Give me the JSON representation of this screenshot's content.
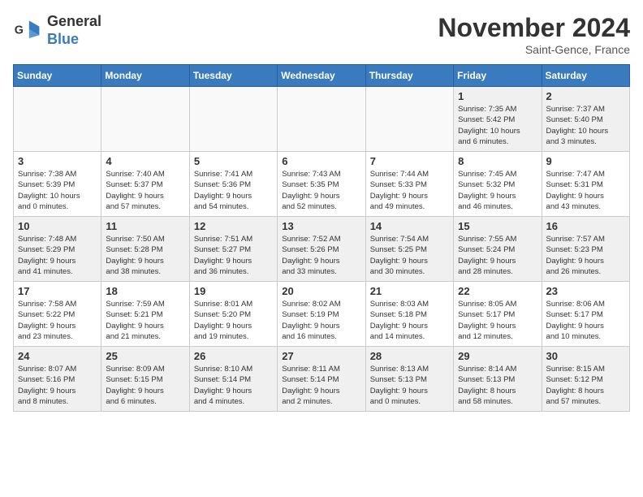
{
  "logo": {
    "line1": "General",
    "line2": "Blue"
  },
  "title": "November 2024",
  "location": "Saint-Gence, France",
  "days_of_week": [
    "Sunday",
    "Monday",
    "Tuesday",
    "Wednesday",
    "Thursday",
    "Friday",
    "Saturday"
  ],
  "weeks": [
    [
      {
        "day": "",
        "info": "",
        "empty": true
      },
      {
        "day": "",
        "info": "",
        "empty": true
      },
      {
        "day": "",
        "info": "",
        "empty": true
      },
      {
        "day": "",
        "info": "",
        "empty": true
      },
      {
        "day": "",
        "info": "",
        "empty": true
      },
      {
        "day": "1",
        "info": "Sunrise: 7:35 AM\nSunset: 5:42 PM\nDaylight: 10 hours\nand 6 minutes."
      },
      {
        "day": "2",
        "info": "Sunrise: 7:37 AM\nSunset: 5:40 PM\nDaylight: 10 hours\nand 3 minutes."
      }
    ],
    [
      {
        "day": "3",
        "info": "Sunrise: 7:38 AM\nSunset: 5:39 PM\nDaylight: 10 hours\nand 0 minutes."
      },
      {
        "day": "4",
        "info": "Sunrise: 7:40 AM\nSunset: 5:37 PM\nDaylight: 9 hours\nand 57 minutes."
      },
      {
        "day": "5",
        "info": "Sunrise: 7:41 AM\nSunset: 5:36 PM\nDaylight: 9 hours\nand 54 minutes."
      },
      {
        "day": "6",
        "info": "Sunrise: 7:43 AM\nSunset: 5:35 PM\nDaylight: 9 hours\nand 52 minutes."
      },
      {
        "day": "7",
        "info": "Sunrise: 7:44 AM\nSunset: 5:33 PM\nDaylight: 9 hours\nand 49 minutes."
      },
      {
        "day": "8",
        "info": "Sunrise: 7:45 AM\nSunset: 5:32 PM\nDaylight: 9 hours\nand 46 minutes."
      },
      {
        "day": "9",
        "info": "Sunrise: 7:47 AM\nSunset: 5:31 PM\nDaylight: 9 hours\nand 43 minutes."
      }
    ],
    [
      {
        "day": "10",
        "info": "Sunrise: 7:48 AM\nSunset: 5:29 PM\nDaylight: 9 hours\nand 41 minutes."
      },
      {
        "day": "11",
        "info": "Sunrise: 7:50 AM\nSunset: 5:28 PM\nDaylight: 9 hours\nand 38 minutes."
      },
      {
        "day": "12",
        "info": "Sunrise: 7:51 AM\nSunset: 5:27 PM\nDaylight: 9 hours\nand 36 minutes."
      },
      {
        "day": "13",
        "info": "Sunrise: 7:52 AM\nSunset: 5:26 PM\nDaylight: 9 hours\nand 33 minutes."
      },
      {
        "day": "14",
        "info": "Sunrise: 7:54 AM\nSunset: 5:25 PM\nDaylight: 9 hours\nand 30 minutes."
      },
      {
        "day": "15",
        "info": "Sunrise: 7:55 AM\nSunset: 5:24 PM\nDaylight: 9 hours\nand 28 minutes."
      },
      {
        "day": "16",
        "info": "Sunrise: 7:57 AM\nSunset: 5:23 PM\nDaylight: 9 hours\nand 26 minutes."
      }
    ],
    [
      {
        "day": "17",
        "info": "Sunrise: 7:58 AM\nSunset: 5:22 PM\nDaylight: 9 hours\nand 23 minutes."
      },
      {
        "day": "18",
        "info": "Sunrise: 7:59 AM\nSunset: 5:21 PM\nDaylight: 9 hours\nand 21 minutes."
      },
      {
        "day": "19",
        "info": "Sunrise: 8:01 AM\nSunset: 5:20 PM\nDaylight: 9 hours\nand 19 minutes."
      },
      {
        "day": "20",
        "info": "Sunrise: 8:02 AM\nSunset: 5:19 PM\nDaylight: 9 hours\nand 16 minutes."
      },
      {
        "day": "21",
        "info": "Sunrise: 8:03 AM\nSunset: 5:18 PM\nDaylight: 9 hours\nand 14 minutes."
      },
      {
        "day": "22",
        "info": "Sunrise: 8:05 AM\nSunset: 5:17 PM\nDaylight: 9 hours\nand 12 minutes."
      },
      {
        "day": "23",
        "info": "Sunrise: 8:06 AM\nSunset: 5:17 PM\nDaylight: 9 hours\nand 10 minutes."
      }
    ],
    [
      {
        "day": "24",
        "info": "Sunrise: 8:07 AM\nSunset: 5:16 PM\nDaylight: 9 hours\nand 8 minutes."
      },
      {
        "day": "25",
        "info": "Sunrise: 8:09 AM\nSunset: 5:15 PM\nDaylight: 9 hours\nand 6 minutes."
      },
      {
        "day": "26",
        "info": "Sunrise: 8:10 AM\nSunset: 5:14 PM\nDaylight: 9 hours\nand 4 minutes."
      },
      {
        "day": "27",
        "info": "Sunrise: 8:11 AM\nSunset: 5:14 PM\nDaylight: 9 hours\nand 2 minutes."
      },
      {
        "day": "28",
        "info": "Sunrise: 8:13 AM\nSunset: 5:13 PM\nDaylight: 9 hours\nand 0 minutes."
      },
      {
        "day": "29",
        "info": "Sunrise: 8:14 AM\nSunset: 5:13 PM\nDaylight: 8 hours\nand 58 minutes."
      },
      {
        "day": "30",
        "info": "Sunrise: 8:15 AM\nSunset: 5:12 PM\nDaylight: 8 hours\nand 57 minutes."
      }
    ]
  ]
}
